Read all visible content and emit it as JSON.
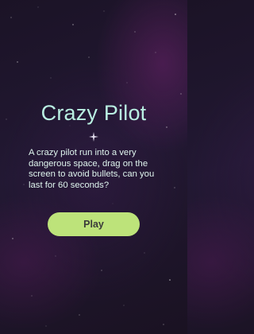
{
  "game": {
    "title": "Crazy Pilot",
    "description": "A crazy pilot run into a very dangerous space, drag on the screen to avoid bullets, can you last for 60 seconds?",
    "play_label": "Play"
  },
  "colors": {
    "title": "#b9f0e2",
    "text": "#dff5ee",
    "button_bg": "#bde37a",
    "button_text": "#3a3a3a",
    "background": "#1f1630"
  },
  "icons": {
    "divider": "sparkle-icon"
  }
}
